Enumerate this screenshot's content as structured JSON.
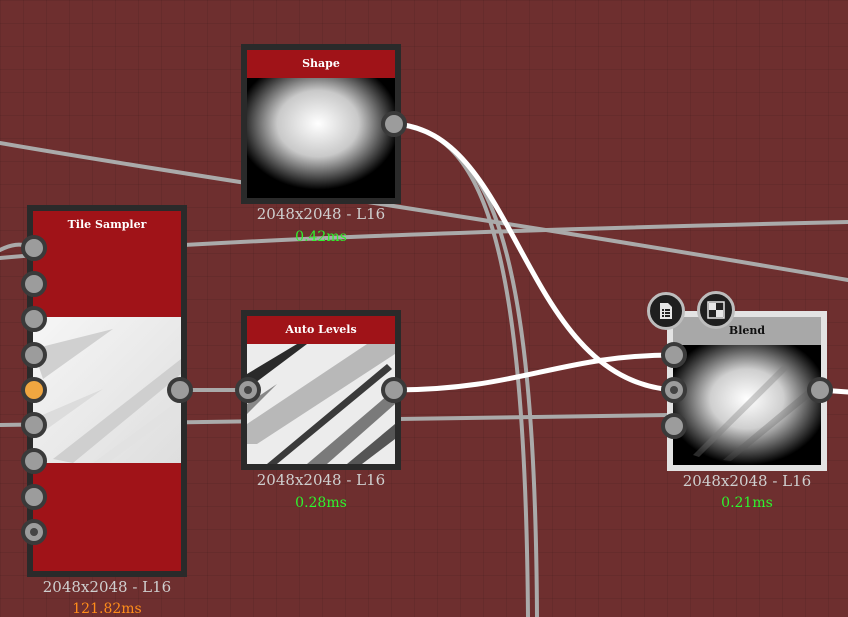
{
  "nodes": {
    "shape": {
      "title": "Shape",
      "resolution": "2048x2048 - L16",
      "time": "0.42ms",
      "time_color": "#2ef32e"
    },
    "tile_sampler": {
      "title": "Tile Sampler",
      "resolution": "2048x2048 - L16",
      "time": "121.82ms",
      "time_color": "#ff8c1a"
    },
    "auto_levels": {
      "title": "Auto Levels",
      "resolution": "2048x2048 - L16",
      "time": "0.28ms",
      "time_color": "#2ef32e"
    },
    "blend": {
      "title": "Blend",
      "resolution": "2048x2048 - L16",
      "time": "0.21ms",
      "time_color": "#2ef32e"
    }
  },
  "colors": {
    "canvas": "#6e2f2f",
    "header_red": "#a01318",
    "header_gray": "#a8a8a8",
    "wire_gray": "#aaaaaa",
    "wire_white": "#ffffff",
    "active_port": "#f0a640"
  },
  "blend_tools": {
    "left_icon": "document-list-icon",
    "right_icon": "checkerboard-icon"
  }
}
